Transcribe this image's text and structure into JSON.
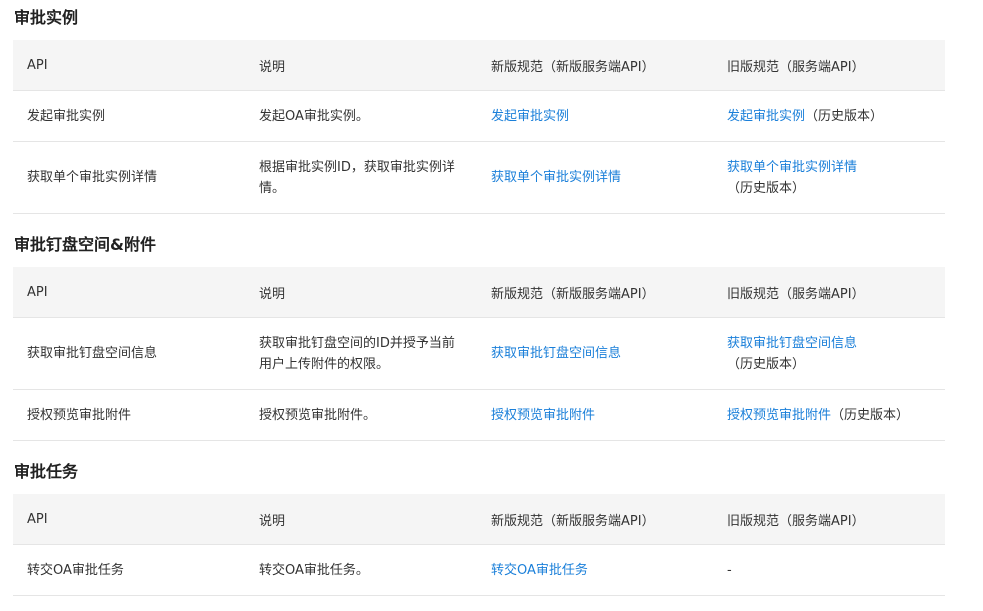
{
  "header": {
    "api": "API",
    "desc": "说明",
    "new": "新版规范（新版服务端API）",
    "old": "旧版规范（服务端API）"
  },
  "sections": [
    {
      "title": "审批实例",
      "rows": [
        {
          "api": "发起审批实例",
          "desc": "发起OA审批实例。",
          "new_link": "发起审批实例",
          "old_link": "发起审批实例",
          "old_note": "（历史版本）"
        },
        {
          "api": "获取单个审批实例详情",
          "desc": "根据审批实例ID，获取审批实例详情。",
          "new_link": "获取单个审批实例详情",
          "old_link": "获取单个审批实例详情",
          "old_note": "（历史版本）"
        }
      ]
    },
    {
      "title": "审批钉盘空间&附件",
      "rows": [
        {
          "api": "获取审批钉盘空间信息",
          "desc": "获取审批钉盘空间的ID并授予当前用户上传附件的权限。",
          "new_link": "获取审批钉盘空间信息",
          "old_link": "获取审批钉盘空间信息",
          "old_note": "（历史版本）"
        },
        {
          "api": "授权预览审批附件",
          "desc": "授权预览审批附件。",
          "new_link": "授权预览审批附件",
          "old_link": "授权预览审批附件",
          "old_note": "（历史版本）"
        }
      ]
    },
    {
      "title": "审批任务",
      "rows": [
        {
          "api": "转交OA审批任务",
          "desc": "转交OA审批任务。",
          "new_link": "转交OA审批任务",
          "old_dash": "-"
        }
      ]
    }
  ]
}
